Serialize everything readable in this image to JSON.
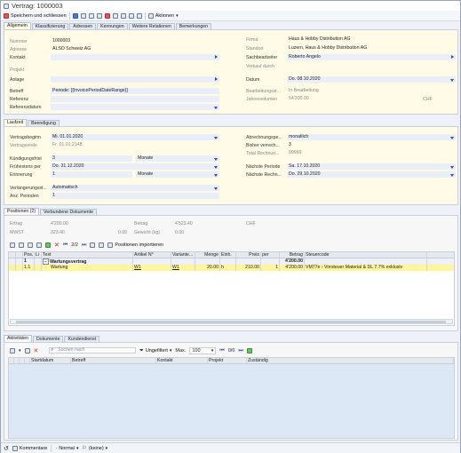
{
  "window": {
    "title": "Vertrag: 1000003"
  },
  "toolbar": {
    "save_close": "Speichern und schliessen",
    "actions": "Aktionen"
  },
  "top_tabs": [
    "Allgemein",
    "Klassifizierung",
    "Adressen",
    "Kennungen",
    "Weitere Relationen",
    "Bemerkungen"
  ],
  "general": {
    "left": [
      {
        "label": "Nummer",
        "value": "1000003",
        "dim": false
      },
      {
        "label": "Adresse",
        "value": "ALSO Schweiz AG",
        "dim": false
      },
      {
        "label": "Kontakt",
        "value": "",
        "dim": false
      },
      {
        "label": "Projekt",
        "value": "",
        "dim": true
      },
      {
        "label": "Anlage",
        "value": "",
        "dim": false
      },
      {
        "label": "Betreff",
        "value": "Periode: [{InvoicePeriodDateRange}]",
        "dim": false
      },
      {
        "label": "Referenz",
        "value": "",
        "dim": false
      },
      {
        "label": "Referenzdatum",
        "value": "",
        "dim": false
      }
    ],
    "right": [
      {
        "label": "Firma",
        "value": "Haus & Hobby Distribution AG"
      },
      {
        "label": "Standort",
        "value": "Luzern, Haus & Hobby Distribution AG"
      },
      {
        "label": "Sachbearbeiter",
        "value": "Roberto Angelo"
      },
      {
        "label": "Verkauf durch",
        "value": ""
      },
      {
        "label": "Datum",
        "value": "Do. 08.10.2020"
      },
      {
        "label": "Bearbeitungsst...",
        "value": "In Bearbeitung"
      },
      {
        "label": "Jahresvolumen",
        "value": "54'200.00",
        "unit": "CHF"
      }
    ]
  },
  "duration_tabs": [
    "Laufzeit",
    "Beendigung"
  ],
  "duration": {
    "left": [
      {
        "label": "Vertragsbeginn",
        "value": "Mi. 01.01.2020"
      },
      {
        "label": "Vertragsende",
        "value": "Fr. 01.01.2148"
      },
      {
        "label": "Kündigungsfrist",
        "value": "3",
        "value2": "Monate"
      },
      {
        "label": "Frühestens per",
        "value": "Do. 31.12.2020"
      },
      {
        "label": "Erinnerung",
        "value": "1",
        "value2": "Monate"
      },
      {
        "label": "Verlängerungsst...",
        "value": "Automatisch"
      },
      {
        "label": "Anz. Perioden",
        "value": "1"
      }
    ],
    "right": [
      {
        "label": "Abrechnungspe...",
        "value": "monatlich"
      },
      {
        "label": "Bisher verrech...",
        "value": "3"
      },
      {
        "label": "Total Rechnun...",
        "value": "99999"
      },
      {
        "label": "Nächste Periode",
        "value": "Sa. 17.10.2020"
      },
      {
        "label": "Nächste Rechn...",
        "value": "Do. 29.10.2020"
      }
    ]
  },
  "positions_tabs": [
    "Positionen (2)",
    "Verbundene Dokumente"
  ],
  "positions_summary": {
    "ertrag_label": "Ertrag",
    "ertrag_value": "4'200.00",
    "betrag_label": "Betrag",
    "betrag_value": "4'523.40",
    "currency": "CHF",
    "mwst_label": "MWST",
    "mwst_value": "323.40",
    "mwst_value2": "0.00",
    "gewicht_label": "Gewicht (kg)",
    "gewicht_value": "0.00"
  },
  "positions_toolbar": {
    "pager": "2/2",
    "import": "Positionen importieren"
  },
  "positions_grid": {
    "headers": [
      "",
      "",
      "Pos.",
      "Li",
      "Text",
      "Artikel N°",
      "Variante...",
      "Menge",
      "Einh.",
      "Preis",
      "per",
      "Betrag",
      "Steuercode"
    ],
    "group_row": {
      "pos": "1",
      "text": "Wartungsvertrag",
      "betrag": "4'200.00"
    },
    "rows": [
      {
        "pos": "1.1",
        "text": "Wartung",
        "artikel": "W1",
        "variante": "W1",
        "menge": "20.00",
        "einh": "h",
        "preis": "210.00",
        "per": "1",
        "betrag": "4'200.00",
        "steuer": "VM77e - Vorsteuer Material & DL 7.7% exklusiv"
      }
    ]
  },
  "activity_tabs": [
    "Aktivitäten",
    "Dokumente",
    "Kundendienst"
  ],
  "activity_toolbar": {
    "search_placeholder": "Suchen nach",
    "filter": "Ungefiltert",
    "max_label": "Max.",
    "max_value": "100",
    "pager": "0/0"
  },
  "activity_grid": {
    "headers": [
      "",
      "",
      "",
      "",
      "Startdatum",
      "Betreff",
      "Kontakt",
      "Projekt",
      "Zuständig"
    ]
  },
  "statusbar": {
    "comments": "Kommentare",
    "priority": "Normal",
    "flag": "(keine)"
  }
}
